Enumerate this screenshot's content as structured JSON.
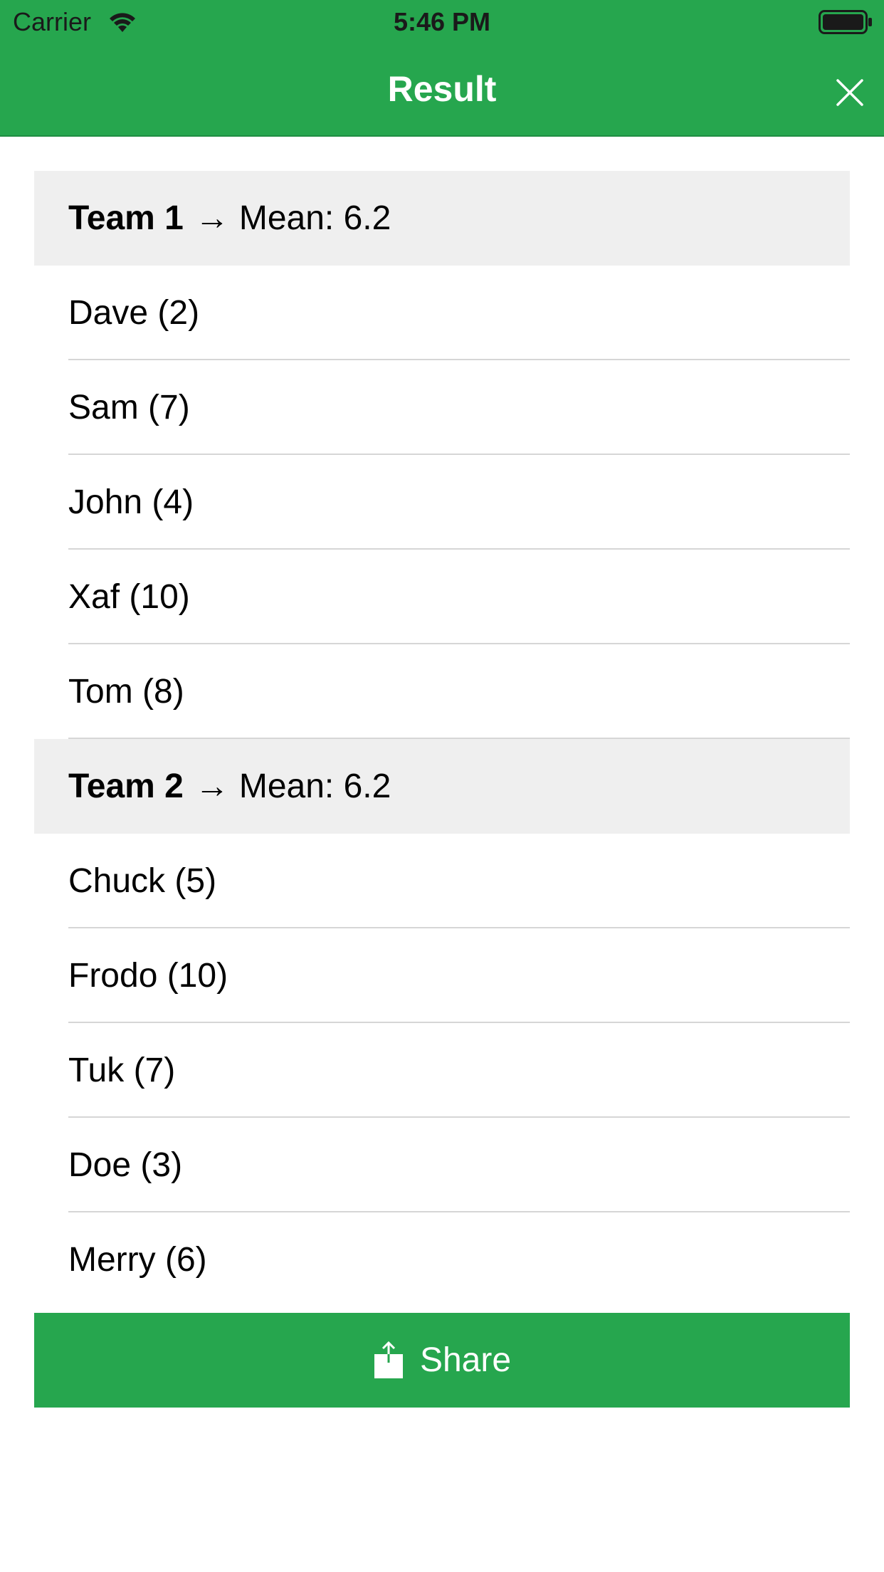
{
  "status_bar": {
    "carrier": "Carrier",
    "time": "5:46 PM"
  },
  "nav": {
    "title": "Result",
    "close_icon": "close-icon"
  },
  "teams": [
    {
      "name": "Team 1",
      "arrow": "→",
      "mean_label": "Mean: 6.2",
      "members": [
        "Dave (2)",
        "Sam (7)",
        "John (4)",
        "Xaf (10)",
        "Tom (8)"
      ]
    },
    {
      "name": "Team 2",
      "arrow": "→",
      "mean_label": "Mean: 6.2",
      "members": [
        "Chuck (5)",
        "Frodo (10)",
        "Tuk (7)",
        "Doe (3)",
        "Merry (6)"
      ]
    }
  ],
  "share": {
    "label": "Share",
    "icon": "share-icon"
  },
  "colors": {
    "accent": "#26a64e",
    "section_bg": "#efefef"
  }
}
